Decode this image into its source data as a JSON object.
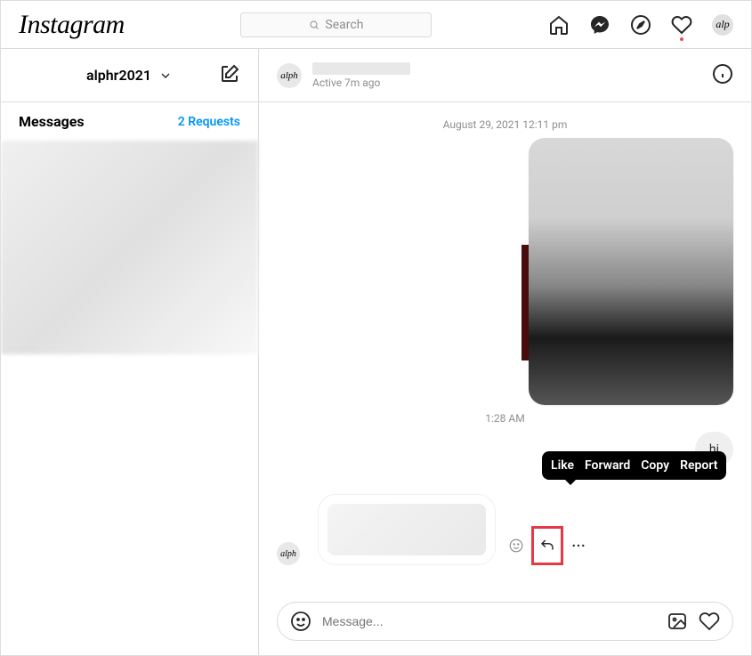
{
  "brand": "Instagram",
  "search": {
    "placeholder": "Search"
  },
  "sidebar": {
    "username": "alphr2021",
    "messages_label": "Messages",
    "requests_label": "2 Requests"
  },
  "chat": {
    "avatar_text": "alph",
    "status": "Active 7m ago",
    "timestamps": {
      "t1": "August 29, 2021 12:11 pm",
      "t2": "1:28 AM"
    },
    "messages": {
      "hi": "hi"
    },
    "tooltip": {
      "like": "Like",
      "forward": "Forward",
      "copy": "Copy",
      "report": "Report"
    }
  },
  "composer": {
    "placeholder": "Message..."
  },
  "nav_avatar": "alp"
}
